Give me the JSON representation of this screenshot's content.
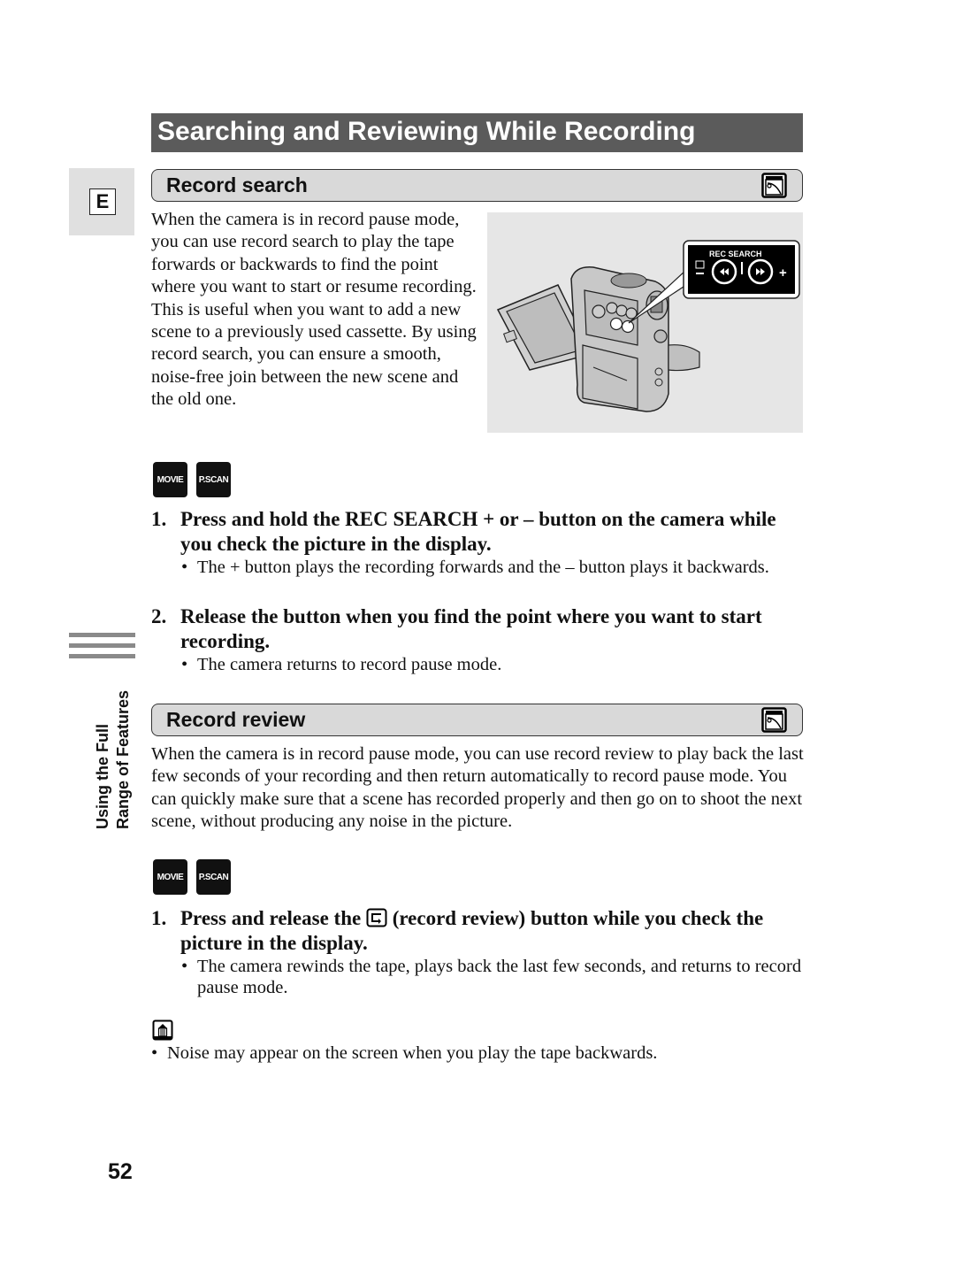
{
  "page": {
    "title": "Searching and Reviewing While Recording",
    "language_tab": "E",
    "side_label": {
      "line1": "Using the Full",
      "line2": "Range of Features"
    },
    "page_number": "52"
  },
  "record_search": {
    "heading": "Record search",
    "heading_icon": "recording-mode-icon",
    "intro": "When the camera is in record pause mode, you can use record search to play the tape forwards or backwards to find the point where you want to start or resume recording. This is useful when you want to add a new scene to a previously used cassette. By using record search, you can ensure a smooth, noise-free join between the new scene and the old one.",
    "figure": {
      "description": "camcorder-illustration",
      "callout_label": "REC SEARCH",
      "callout_minus": "–",
      "callout_plus": "+",
      "callout_rewind_icon": "rewind-icon",
      "callout_forward_icon": "fast-forward-icon",
      "callout_review_icon": "record-review-icon"
    },
    "modes": [
      "MOVIE",
      "P.SCAN"
    ],
    "steps": [
      {
        "number": "1.",
        "text": "Press and hold the REC SEARCH + or – button on the camera while you check the picture in the display.",
        "bullets": [
          "The + button plays the recording forwards and the – button plays it backwards."
        ]
      },
      {
        "number": "2.",
        "text": "Release the button when you find the point where you want to start recording.",
        "bullets": [
          "The camera returns to record pause mode."
        ]
      }
    ]
  },
  "record_review": {
    "heading": "Record review",
    "heading_icon": "recording-mode-icon",
    "intro": "When the camera is in record pause mode, you can use record review to play back the last few seconds of your recording and then return automatically to record pause mode. You can quickly make sure that a scene has recorded properly and then go on to shoot the next scene, without producing any noise in the picture.",
    "modes": [
      "MOVIE",
      "P.SCAN"
    ],
    "steps": [
      {
        "number": "1.",
        "text_before_icon": "Press and release the",
        "inline_icon": "record-review-icon",
        "text_after_icon": "(record review) button while you check the picture in the display.",
        "bullets": [
          "The camera rewinds the tape, plays back the last few seconds, and returns to record pause mode."
        ]
      }
    ]
  },
  "note": {
    "icon": "note-icon",
    "bullets": [
      "Noise may appear on the screen when you play the tape backwards."
    ]
  }
}
